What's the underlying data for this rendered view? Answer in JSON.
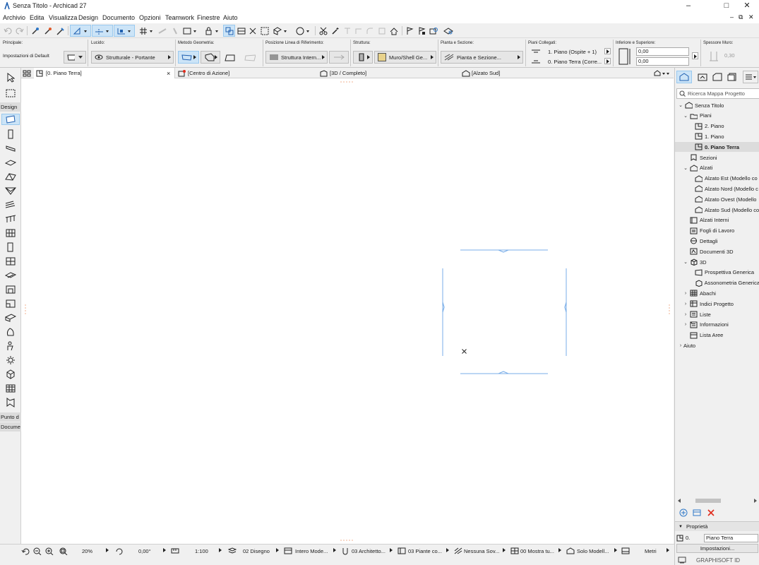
{
  "window": {
    "title": "Senza Titolo - Archicad 27"
  },
  "menu": [
    "Archivio",
    "Edita",
    "Visualizza",
    "Design",
    "Documento",
    "Opzioni",
    "Teamwork",
    "Finestre",
    "Aiuto"
  ],
  "infobox": {
    "principale": {
      "label": "Principale:",
      "value": "Impostazioni di Default"
    },
    "lucido": {
      "label": "Lucido:",
      "value": "Strutturale - Portante"
    },
    "metodo": {
      "label": "Metodo Geometria:"
    },
    "posizione": {
      "label": "Posizione Linea di Riferimento:",
      "value": "Struttura Intern..."
    },
    "struttura": {
      "label": "Struttura:",
      "value": "Muro/Shell Ge..."
    },
    "pianta": {
      "label": "Pianta e Sezione:",
      "value": "Pianta e Sezione..."
    },
    "piani": {
      "label": "Piani Collegati:",
      "top": "1. Piano (Ospite + 1)",
      "bottom": "0. Piano Terra (Corre..."
    },
    "inferiore": {
      "label": "Inferiore e Superiore:",
      "top_value": "0,00",
      "bottom_value": "0,00"
    },
    "spessore": {
      "label": "Spessore Muro:",
      "value": "0,30"
    }
  },
  "toolbox": {
    "design_label": "Design",
    "punto_label": "Punto d",
    "documento_label": "Docume"
  },
  "tabs": {
    "plan": "[0. Piano Terra]",
    "close": "×",
    "center": "[Centro di Azione]",
    "three_d": "[3D / Completo]",
    "alzato": "[Alzato Sud]"
  },
  "navigator": {
    "search_placeholder": "Ricerca Mappa Progetto",
    "tree": [
      {
        "label": "Senza Titolo",
        "exp": "⌄",
        "level": 0,
        "icon": "project-icon"
      },
      {
        "label": "Piani",
        "exp": "⌄",
        "level": 1,
        "icon": "folder-icon"
      },
      {
        "label": "2. Piano",
        "exp": "",
        "level": 2,
        "icon": "story-icon"
      },
      {
        "label": "1. Piano",
        "exp": "",
        "level": 2,
        "icon": "story-icon"
      },
      {
        "label": "0. Piano Terra",
        "exp": "",
        "level": 2,
        "icon": "story-icon",
        "selected": true
      },
      {
        "label": "Sezioni",
        "exp": "",
        "level": 1,
        "icon": "section-icon"
      },
      {
        "label": "Alzati",
        "exp": "⌄",
        "level": 1,
        "icon": "elevation-icon"
      },
      {
        "label": "Alzato Est (Modello co",
        "exp": "",
        "level": 2,
        "icon": "elevation-icon"
      },
      {
        "label": "Alzato Nord (Modello c",
        "exp": "",
        "level": 2,
        "icon": "elevation-icon"
      },
      {
        "label": "Alzato Ovest (Modello",
        "exp": "",
        "level": 2,
        "icon": "elevation-icon"
      },
      {
        "label": "Alzato Sud (Modello co",
        "exp": "",
        "level": 2,
        "icon": "elevation-icon"
      },
      {
        "label": "Alzati Interni",
        "exp": "",
        "level": 1,
        "icon": "interior-elevation-icon"
      },
      {
        "label": "Fogli di Lavoro",
        "exp": "",
        "level": 1,
        "icon": "worksheet-icon"
      },
      {
        "label": "Dettagli",
        "exp": "",
        "level": 1,
        "icon": "detail-icon"
      },
      {
        "label": "Documenti 3D",
        "exp": "",
        "level": 1,
        "icon": "document-3d-icon"
      },
      {
        "label": "3D",
        "exp": "⌄",
        "level": 1,
        "icon": "cube-icon"
      },
      {
        "label": "Prospettiva Generica",
        "exp": "",
        "level": 2,
        "icon": "perspective-icon"
      },
      {
        "label": "Assonometria Generica",
        "exp": "",
        "level": 2,
        "icon": "axonometry-icon"
      },
      {
        "label": "Abachi",
        "exp": "›",
        "level": 1,
        "icon": "schedule-icon"
      },
      {
        "label": "Indici Progetto",
        "exp": "›",
        "level": 1,
        "icon": "index-icon"
      },
      {
        "label": "Liste",
        "exp": "›",
        "level": 1,
        "icon": "list-icon"
      },
      {
        "label": "Informazioni",
        "exp": "›",
        "level": 1,
        "icon": "info-icon"
      },
      {
        "label": "Lista Aree",
        "exp": "",
        "level": 1,
        "icon": "area-list-icon"
      },
      {
        "label": "Aiuto",
        "exp": "›",
        "level": 0,
        "icon": "help-icon"
      }
    ],
    "properties_label": "Proprietà",
    "properties_id": "0.",
    "properties_name": "Piano Terra",
    "settings_button": "Impostazioni..."
  },
  "statusbar": {
    "zoom": "20%",
    "angle": "0,00°",
    "scale": "1:100",
    "layer_combo": "02 Disegno",
    "model_view": "Intero Mode...",
    "pen_set": "03 Architetto...",
    "mvo": "03 Piante co...",
    "override": "Nessuna Sov...",
    "renovation": "00 Mostra tu...",
    "structure": "Solo Modell...",
    "units": "Metri"
  },
  "brand": "GRAPHISOFT ID",
  "colors": {
    "accent": "#99c9ef",
    "selection": "#cce4f7",
    "draw_line": "#6fa8e6",
    "delete": "#e02a1b"
  }
}
